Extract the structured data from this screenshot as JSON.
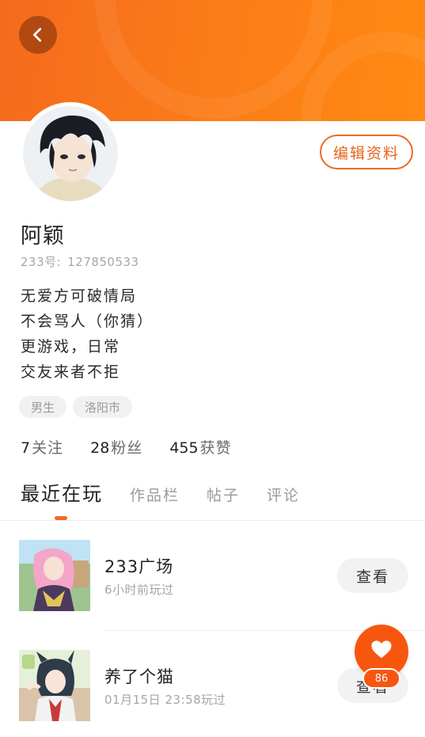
{
  "header": {
    "back_icon": "chevron-left-icon",
    "accent_color": "#f56a1e"
  },
  "profile": {
    "username": "阿颖",
    "uid_label": "233号:",
    "uid_value": "127850533",
    "edit_button": "编辑资料",
    "bio_lines": [
      "无爱方可破情局",
      "不会骂人（你猜）",
      "更游戏，日常",
      "交友来者不拒"
    ],
    "tags": [
      "男生",
      "洛阳市"
    ]
  },
  "stats": {
    "following": {
      "value": "7",
      "label": "关注"
    },
    "fans": {
      "value": "28",
      "label": "粉丝"
    },
    "likes": {
      "value": "455",
      "label": "获赞"
    }
  },
  "tabs": [
    "最近在玩",
    "作品栏",
    "帖子",
    "评论"
  ],
  "active_tab": "最近在玩",
  "games": [
    {
      "title": "233广场",
      "time": "6小时前玩过",
      "button": "查看"
    },
    {
      "title": "养了个猫",
      "time": "01月15日 23:58玩过",
      "button": "查看"
    }
  ],
  "like_fab": {
    "icon": "heart-icon",
    "count": "86"
  }
}
